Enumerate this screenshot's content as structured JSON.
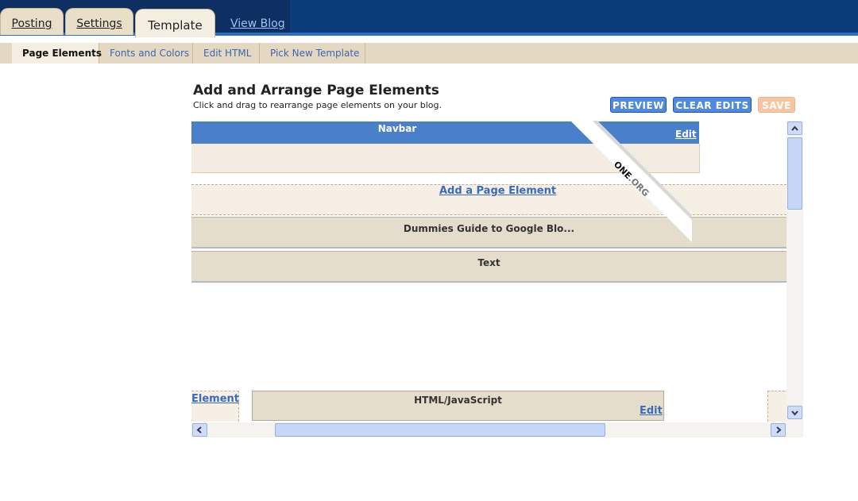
{
  "tabs": [
    {
      "label": "Posting"
    },
    {
      "label": "Settings"
    },
    {
      "label": "Template"
    }
  ],
  "view_blog": "View Blog",
  "subnav": [
    "Page Elements",
    "Fonts and Colors",
    "Edit HTML",
    "Pick New Template"
  ],
  "page": {
    "title": "Add and Arrange Page Elements",
    "subtitle": "Click and drag to rearrange page elements on your blog."
  },
  "buttons": {
    "preview": "PREVIEW",
    "clear_edits": "CLEAR EDITS",
    "save": "SAVE"
  },
  "layout": {
    "navbar_title": "Navbar",
    "edit_label": "Edit",
    "add_element": "Add a Page Element",
    "widget_1": "Dummies Guide to Google Blo...",
    "widget_2": "Text",
    "bottom_left_link": "Element",
    "html_widget": "HTML/JavaScript",
    "html_edit": "Edit"
  },
  "sash": {
    "part1": "ONE",
    "part2": ".ORG"
  },
  "colors": {
    "header_bg": "#0b3c7a",
    "navbar_blue": "#4a80c9",
    "link_blue": "#3a6bbb",
    "tan": "#e5ddcb"
  }
}
